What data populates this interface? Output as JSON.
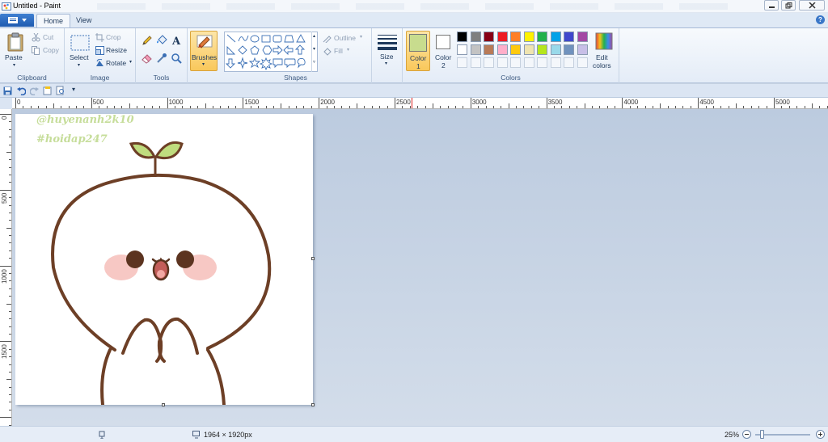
{
  "window": {
    "title": "Untitled - Paint"
  },
  "tabs": {
    "home": "Home",
    "view": "View"
  },
  "clipboard": {
    "group": "Clipboard",
    "paste": "Paste",
    "cut": "Cut",
    "copy": "Copy"
  },
  "image": {
    "group": "Image",
    "select": "Select",
    "crop": "Crop",
    "resize": "Resize",
    "rotate": "Rotate"
  },
  "tools": {
    "group": "Tools"
  },
  "brushes": {
    "label": "Brushes"
  },
  "shapes": {
    "group": "Shapes",
    "outline": "Outline",
    "fill": "Fill"
  },
  "size": {
    "label": "Size"
  },
  "colors": {
    "group": "Colors",
    "color1": "Color",
    "color1_num": "1",
    "color2": "Color",
    "color2_num": "2",
    "edit": "Edit",
    "edit2": "colors",
    "color1_value": "#c8dc8e",
    "color2_value": "#ffffff",
    "palette_row1": [
      "#000000",
      "#7f7f7f",
      "#880015",
      "#ed1c24",
      "#ff7f27",
      "#fff200",
      "#22b14c",
      "#00a2e8",
      "#3f48cc",
      "#a349a4"
    ],
    "palette_row2": [
      "#ffffff",
      "#c3c3c3",
      "#b97a57",
      "#ffaec9",
      "#ffc90e",
      "#efe4b0",
      "#b5e61d",
      "#99d9ea",
      "#7092be",
      "#c8bfe7"
    ]
  },
  "ruler": {
    "h_labels": [
      "0",
      "500",
      "1000",
      "1500",
      "2000",
      "2500",
      "3000",
      "3500",
      "4000",
      "4500",
      "5000"
    ],
    "v_labels": [
      "0",
      "500",
      "1000",
      "1500"
    ]
  },
  "canvas": {
    "watermark1": "@huyenanh2k10",
    "watermark2": "#hoidap247"
  },
  "status": {
    "dimensions": "1964 × 1920px",
    "zoom": "25%"
  }
}
